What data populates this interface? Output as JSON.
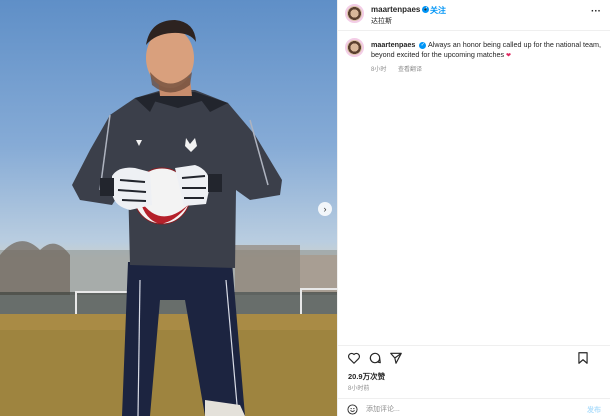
{
  "photo": {
    "alt_subject": "goalkeeper holding ball",
    "next_icon": "chevron-right-icon"
  },
  "header": {
    "username": "maartenpaes",
    "verified_icon": "verified-badge-icon",
    "separator": "•",
    "follow_label": "关注",
    "location": "达拉斯",
    "more_icon": "more-options-icon"
  },
  "caption": {
    "username": "maartenpaes",
    "text": "Always an honor being called up for the national team, beyond excited for the upcoming matches",
    "emoji": "heart-icon",
    "time_ago": "8小时",
    "translate_label": "查看翻译"
  },
  "actions": {
    "like_icon": "heart-outline-icon",
    "comment_icon": "comment-icon",
    "share_icon": "share-icon",
    "save_icon": "bookmark-icon"
  },
  "stats": {
    "likes": "20.9万次赞",
    "posted": "8小时前"
  },
  "comment": {
    "placeholder": "添加评论...",
    "post_label": "发布",
    "emoji_icon": "smiley-icon"
  },
  "colors": {
    "accent": "#0095f6",
    "verified": "#0095f6",
    "text": "#262626",
    "muted": "#8e8e8e"
  }
}
